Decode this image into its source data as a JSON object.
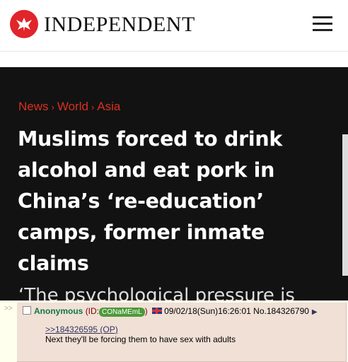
{
  "header": {
    "brand": "INDEPENDENT",
    "logo_icon": "eagle-icon",
    "menu_icon": "hamburger-menu-icon",
    "brand_color": "#e0252b"
  },
  "article": {
    "breadcrumb": [
      "News",
      "World",
      "Asia"
    ],
    "breadcrumb_sep": "›",
    "headline": "Muslims forced to drink alcohol and eat pork in China’s ‘re-education’ camps, former inmate claims",
    "subline": "‘The psychological pressure is"
  },
  "post": {
    "name": "Anonymous",
    "id_prefix": "(ID:",
    "id": "CONaMEmL",
    "id_suffix": ")",
    "date": "09/02/18(Sun)16:26:01",
    "number": "No.184326790",
    "quote": ">>184326595 (OP)",
    "body": "Next they'll be forcing them to have sex with adults",
    "side_arrows": ">>"
  }
}
